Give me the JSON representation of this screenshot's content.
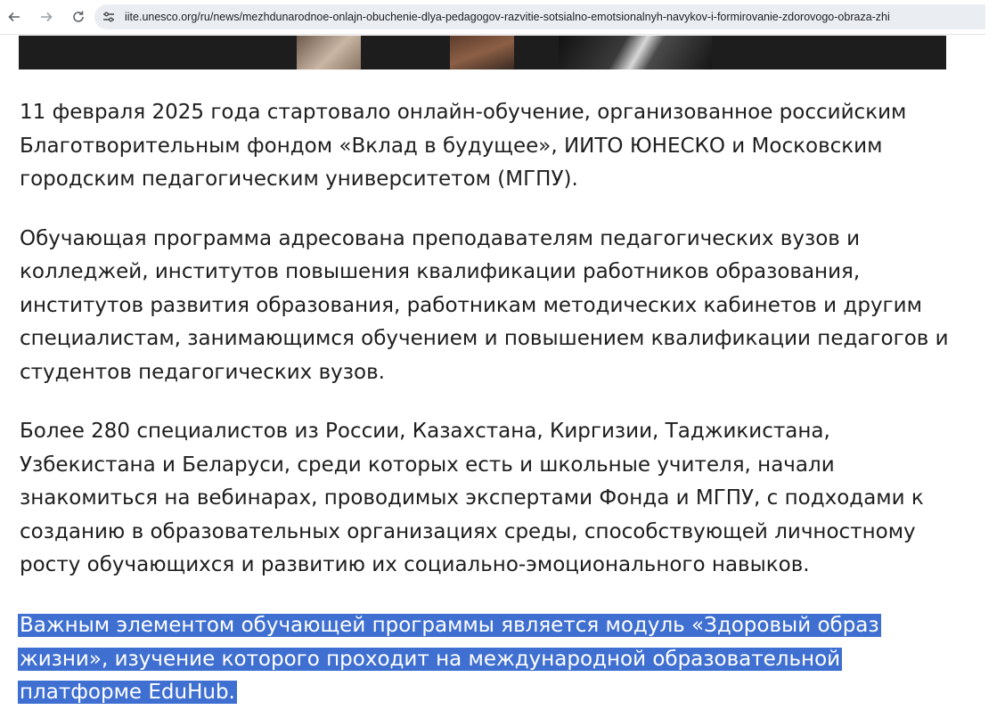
{
  "browser": {
    "url": "iite.unesco.org/ru/news/mezhdunarodnoe-onlajn-obuchenie-dlya-pedagogov-razvitie-sotsialno-emotsionalnyh-navykov-i-formirovanie-zdorovogo-obraza-zhi",
    "icons": {
      "back": "arrow-left",
      "forward": "arrow-right",
      "reload": "reload",
      "site_info": "tune-sliders"
    }
  },
  "article": {
    "paragraphs": [
      "11 февраля 2025 года стартовало онлайн-обучение, организованное российским Благотворительным фондом «Вклад в будущее», ИИТО ЮНЕСКО и Московским городским педагогическим университетом (МГПУ).",
      "Обучающая программа адресована преподавателям педагогических вузов и колледжей, институтов повышения квалификации работников образования, институтов развития образования, работникам методических кабинетов и другим специалистам, занимающимся обучением и повышением квалификации педагогов и студентов педагогических вузов.",
      "Более 280 специалистов из России, Казахстана, Киргизии, Таджикистана, Узбекистана и Беларуси, среди которых есть и школьные учителя, начали знакомиться на вебинарах, проводимых экспертами Фонда и МГПУ, с подходами к созданию в образовательных организациях среды, способствующей личностному росту обучающихся и развитию их социально-эмоционального навыков."
    ],
    "highlighted_paragraph": "Важным элементом обучающей программы является модуль «Здоровый образ жизни», изучение которого проходит на международной образовательной платформе EduHub."
  },
  "colors": {
    "selection": "#3f6fd1",
    "omnibox": "#eaeef3",
    "text": "#1e1e1e"
  }
}
